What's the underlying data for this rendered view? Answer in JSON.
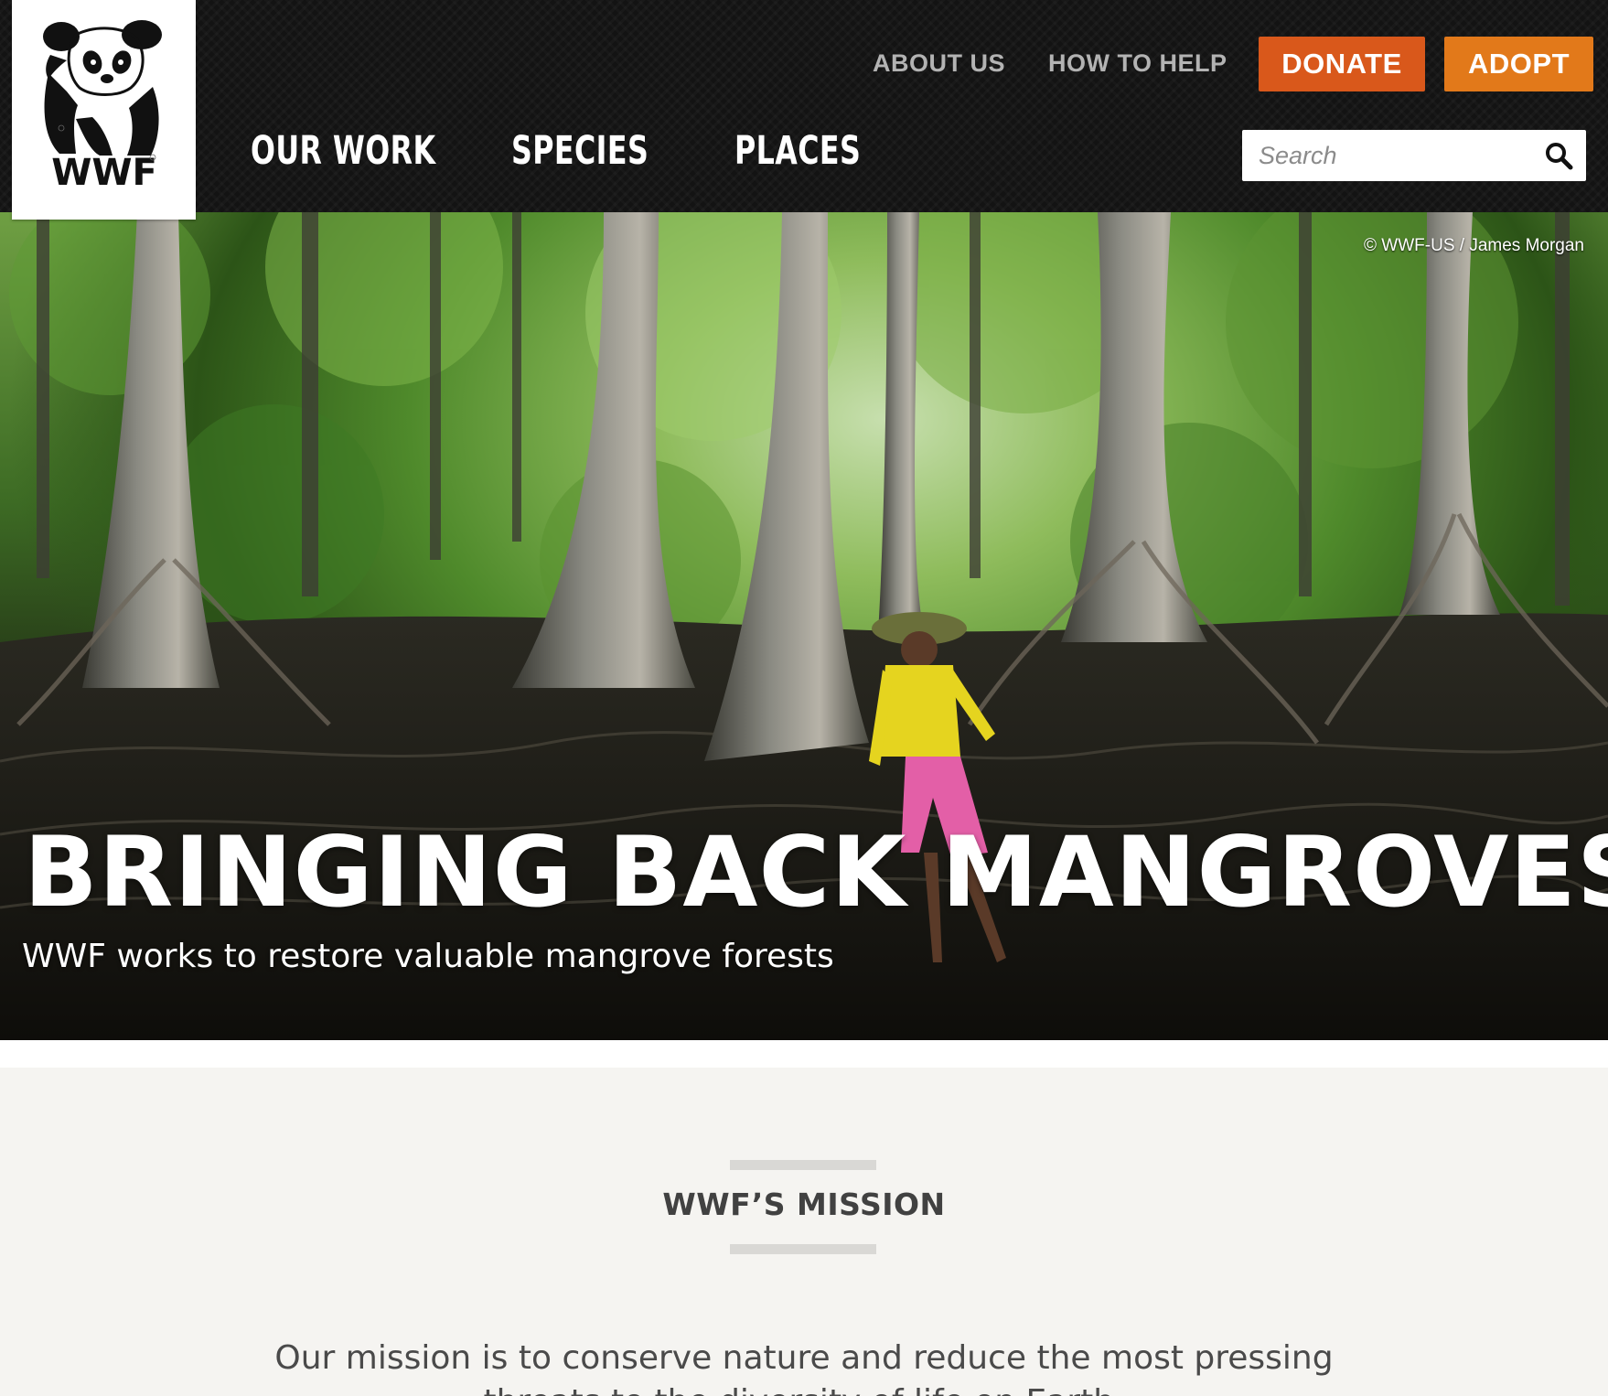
{
  "brand": {
    "logo_text": "WWF",
    "icon": "panda-logo"
  },
  "header": {
    "util_nav": [
      {
        "label": "ABOUT US"
      },
      {
        "label": "HOW TO HELP"
      }
    ],
    "donate_label": "DONATE",
    "adopt_label": "ADOPT",
    "main_nav": [
      {
        "label": "OUR WORK"
      },
      {
        "label": "SPECIES"
      },
      {
        "label": "PLACES"
      }
    ],
    "search": {
      "placeholder": "Search",
      "value": "",
      "icon": "search-icon"
    }
  },
  "hero": {
    "credit": "© WWF-US / James Morgan",
    "title": "BRINGING BACK MANGROVES",
    "subtitle": "WWF works to restore valuable mangrove forests"
  },
  "mission": {
    "heading": "WWF’S MISSION",
    "text": "Our mission is to conserve nature and reduce the most pressing threats to the diversity of life on Earth."
  },
  "colors": {
    "header_bg": "#131313",
    "donate": "#d9581b",
    "adopt": "#e2791a",
    "page_bg": "#f5f4f1"
  }
}
